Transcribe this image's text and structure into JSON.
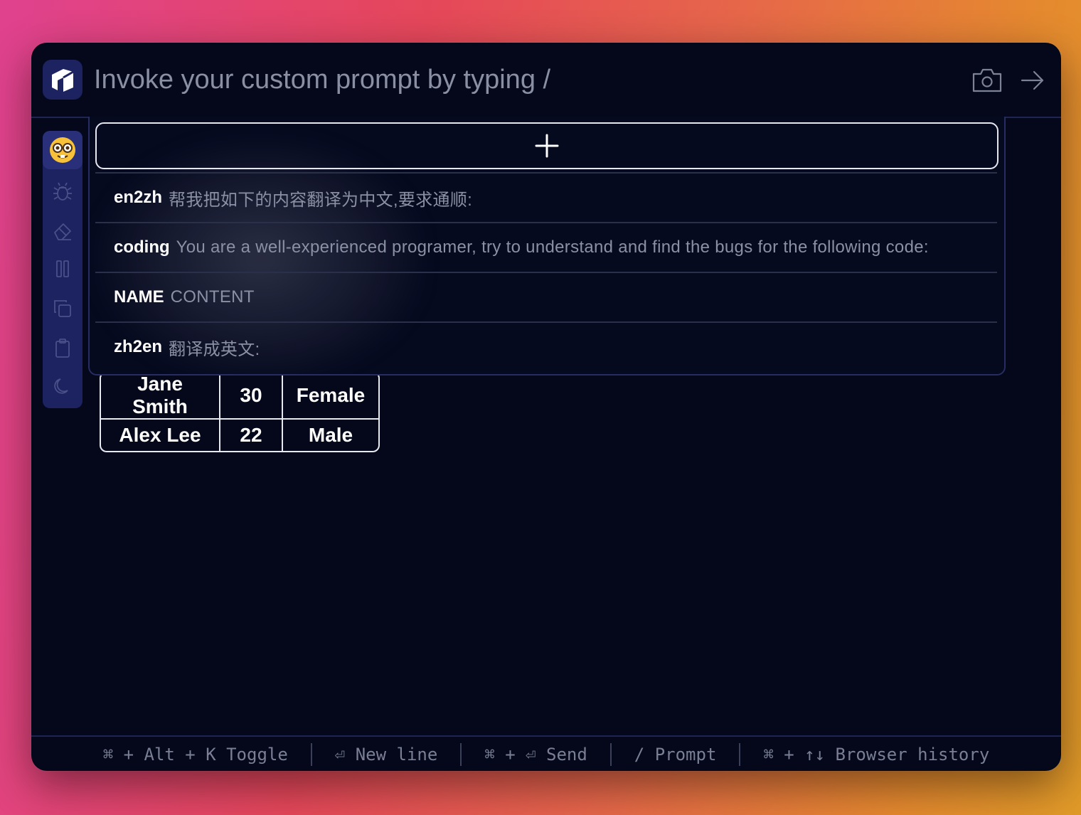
{
  "header": {
    "placeholder": "Invoke your custom prompt by typing /",
    "icons": [
      "app-logo",
      "camera-icon",
      "arrow-right-icon"
    ]
  },
  "sidebar": {
    "items": [
      "nerd-face-emoji",
      "bug-icon",
      "eraser-icon",
      "columns-icon",
      "copy-icon",
      "clipboard-icon",
      "moon-icon"
    ],
    "emoji": "🤓"
  },
  "popup": {
    "add_label": "+",
    "prompts": [
      {
        "name": "en2zh",
        "content": "帮我把如下的内容翻译为中文,要求通顺:"
      },
      {
        "name": "coding",
        "content": "You are a well-experienced programer, try to understand and find the bugs for the following code:"
      },
      {
        "name": "NAME",
        "content": "CONTENT"
      },
      {
        "name": "zh2en",
        "content": "翻译成英文:"
      }
    ]
  },
  "table": {
    "rows": [
      [
        "Jane Smith",
        "30",
        "Female"
      ],
      [
        "Alex Lee",
        "22",
        "Male"
      ]
    ]
  },
  "footer": {
    "hints": [
      "⌘ + Alt + K Toggle",
      "⏎ New line",
      "⌘ + ⏎ Send",
      "/ Prompt",
      "⌘ + ↑↓ Browser history"
    ]
  },
  "colors": {
    "window_bg": "#04081a",
    "sidebar_bg": "#1d2261",
    "accent_border": "#272d63"
  }
}
